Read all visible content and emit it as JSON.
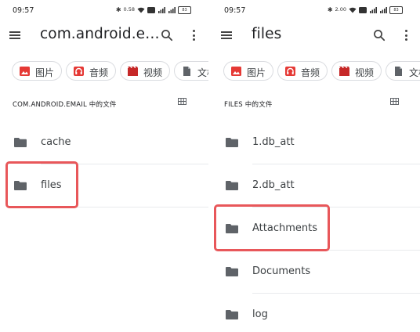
{
  "colors": {
    "highlight": "#e8575a",
    "icon_gray": "#5f6368",
    "image_icon_red": "#e53935",
    "audio_icon_red": "#e53935",
    "video_icon": "#c62828",
    "doc_icon": "#5f6368"
  },
  "left": {
    "status": {
      "time": "09:57",
      "speed": "0.58",
      "battery": "83"
    },
    "title": "com.android.e…",
    "chips": [
      {
        "label": "图片",
        "icon": "image-icon"
      },
      {
        "label": "音频",
        "icon": "headphones-icon"
      },
      {
        "label": "视频",
        "icon": "movie-icon"
      },
      {
        "label": "文档",
        "icon": "document-icon"
      }
    ],
    "section_header": "COM.ANDROID.EMAIL 中的文件",
    "items": [
      {
        "name": "cache"
      },
      {
        "name": "files"
      }
    ]
  },
  "right": {
    "status": {
      "time": "09:57",
      "speed": "2.00",
      "battery": "83"
    },
    "title": "files",
    "chips": [
      {
        "label": "图片",
        "icon": "image-icon"
      },
      {
        "label": "音频",
        "icon": "headphones-icon"
      },
      {
        "label": "视频",
        "icon": "movie-icon"
      },
      {
        "label": "文档",
        "icon": "document-icon"
      }
    ],
    "section_header": "FILES 中的文件",
    "items": [
      {
        "name": "1.db_att"
      },
      {
        "name": "2.db_att"
      },
      {
        "name": "Attachments"
      },
      {
        "name": "Documents"
      },
      {
        "name": "log"
      }
    ]
  }
}
